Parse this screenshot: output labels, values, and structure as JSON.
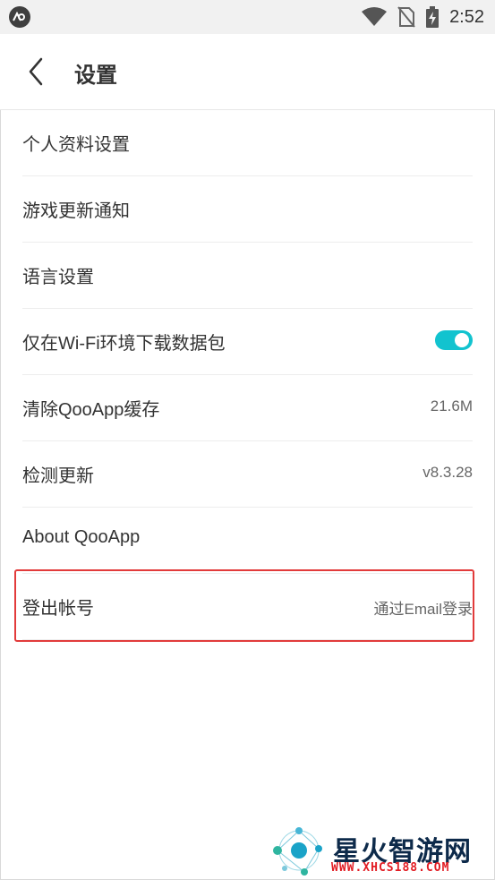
{
  "status_bar": {
    "time": "2:52",
    "icons": [
      "qooapp-icon",
      "wifi-icon",
      "no-sim-icon",
      "battery-charging-icon"
    ]
  },
  "toolbar": {
    "title": "设置"
  },
  "settings": [
    {
      "label": "个人资料设置",
      "value": ""
    },
    {
      "label": "游戏更新通知",
      "value": ""
    },
    {
      "label": "语言设置",
      "value": ""
    },
    {
      "label": "仅在Wi-Fi环境下载数据包",
      "toggle": true
    },
    {
      "label": "清除QooApp缓存",
      "value": "21.6M"
    },
    {
      "label": "检测更新",
      "value": "v8.3.28"
    },
    {
      "label": "About QooApp",
      "value": ""
    },
    {
      "label": "登出帐号",
      "value": "通过Email登录"
    }
  ],
  "watermark": {
    "name": "星火智游网",
    "url": "WWW.XHCS188.COM"
  },
  "colors": {
    "accent": "#12c3cf",
    "highlight": "#e23b3b"
  }
}
